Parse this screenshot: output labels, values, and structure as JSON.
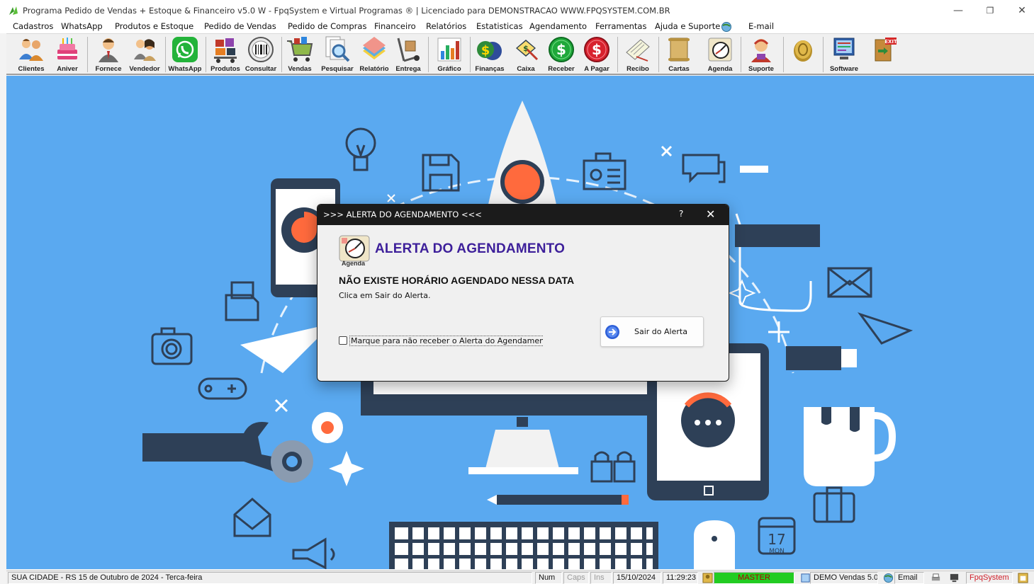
{
  "window": {
    "title": "Programa Pedido de Vendas + Estoque & Financeiro v5.0 W - FpqSystem e Virtual Programas ® | Licenciado para  DEMONSTRACAO WWW.FPQSYSTEM.COM.BR",
    "controls": {
      "minimize": "—",
      "restore": "❐",
      "close": "✕"
    }
  },
  "menu": {
    "items": [
      "Cadastros",
      "WhatsApp",
      "Produtos e Estoque",
      "Pedido de Vendas",
      "Pedido de Compras",
      "Financeiro",
      "Relatórios",
      "Estatisticas",
      "Agendamento",
      "Ferramentas",
      "Ajuda e Suporte",
      "E-mail"
    ]
  },
  "toolbar": {
    "buttons": [
      {
        "label": "Clientes",
        "icon": "clients-icon"
      },
      {
        "label": "Aniver",
        "icon": "birthday-cake-icon"
      },
      {
        "label": "Fornece",
        "icon": "supplier-icon"
      },
      {
        "label": "Vendedor",
        "icon": "seller-icon"
      },
      {
        "label": "WhatsApp",
        "icon": "whatsapp-icon"
      },
      {
        "label": "Produtos",
        "icon": "products-icon"
      },
      {
        "label": "Consultar",
        "icon": "barcode-icon"
      },
      {
        "label": "Vendas",
        "icon": "cart-icon"
      },
      {
        "label": "Pesquisar",
        "icon": "magnifier-icon"
      },
      {
        "label": "Relatório",
        "icon": "report-icon"
      },
      {
        "label": "Entrega",
        "icon": "delivery-icon"
      },
      {
        "label": "Gráfico",
        "icon": "chart-icon"
      },
      {
        "label": "Finanças",
        "icon": "finance-icon"
      },
      {
        "label": "Caixa",
        "icon": "cashbox-icon"
      },
      {
        "label": "Receber",
        "icon": "receive-money-icon"
      },
      {
        "label": "A Pagar",
        "icon": "pay-money-icon"
      },
      {
        "label": "Recibo",
        "icon": "receipt-icon"
      },
      {
        "label": "Cartas",
        "icon": "letters-icon"
      },
      {
        "label": "Agenda",
        "icon": "agenda-icon"
      },
      {
        "label": "Suporte",
        "icon": "support-icon"
      },
      {
        "label": "",
        "icon": "coins-icon"
      },
      {
        "label": "Software",
        "icon": "software-icon"
      },
      {
        "label": "",
        "icon": "exit-door-icon"
      }
    ]
  },
  "dialog": {
    "title": ">>> ALERTA DO AGENDAMENTO <<<",
    "help": "?",
    "close": "✕",
    "icon_caption": "Agenda",
    "heading": "ALERTA DO AGENDAMENTO",
    "message": "NÃO EXISTE HORÁRIO AGENDADO NESSA DATA",
    "hint": "Clica em Sair do Alerta.",
    "checkbox_label": "Marque para não receber o Alerta do Agendamento pa",
    "checkbox_checked": false,
    "exit_button": "Sair do Alerta"
  },
  "background_labels": {
    "calendar_day": "17",
    "calendar_weekday": "MON"
  },
  "statusbar": {
    "location_date": "SUA CIDADE - RS 15 de Outubro de 2024 - Terca-feira",
    "num": "Num",
    "caps": "Caps",
    "ins": "Ins",
    "date": "15/10/2024",
    "time": "11:29:23",
    "user": "MASTER",
    "version": "DEMO Vendas 5.0",
    "email": "Email",
    "brand": "FpqSystem"
  },
  "colors": {
    "workspace": "#5aa9f0",
    "heading": "#3d1f9a",
    "brand_red": "#d0202a",
    "user_green": "#22cc22"
  }
}
